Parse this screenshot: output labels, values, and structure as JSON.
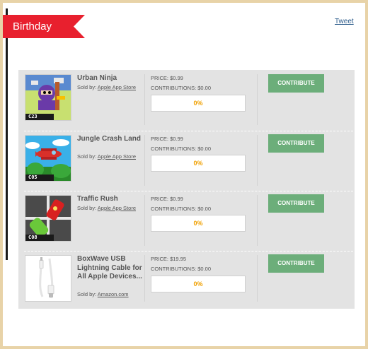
{
  "header": {
    "ribbon_label": "Birthday",
    "tweet_label": "Tweet"
  },
  "items": [
    {
      "title": "Urban Ninja",
      "sold_prefix": "Sold by:",
      "seller": "Apple App Store",
      "price": "PRICE: $0.99",
      "contributions": "CONTRIBUTIONS: $0.00",
      "progress": "0%",
      "button": "CONTRIBUTE",
      "thumb_badge": "C23"
    },
    {
      "title": "Jungle Crash Land",
      "sold_prefix": "Sold by:",
      "seller": "Apple App Store",
      "price": "PRICE: $0.99",
      "contributions": "CONTRIBUTIONS: $0.00",
      "progress": "0%",
      "button": "CONTRIBUTE",
      "thumb_badge": "C05"
    },
    {
      "title": "Traffic Rush",
      "sold_prefix": "Sold by:",
      "seller": "Apple App Store",
      "price": "PRICE: $0.99",
      "contributions": "CONTRIBUTIONS: $0.00",
      "progress": "0%",
      "button": "CONTRIBUTE",
      "thumb_badge": "C08"
    },
    {
      "title": "BoxWave USB Lightning Cable for All Apple Devices...",
      "sold_prefix": "Sold by:",
      "seller": "Amazon.com",
      "price": "PRICE: $19.95",
      "contributions": "CONTRIBUTIONS: $0.00",
      "progress": "0%",
      "button": "CONTRIBUTE"
    }
  ],
  "colors": {
    "ribbon": "#e8202e",
    "button": "#6cae7a",
    "progress_text": "#f0a000",
    "list_bg": "#e3e3e3"
  }
}
